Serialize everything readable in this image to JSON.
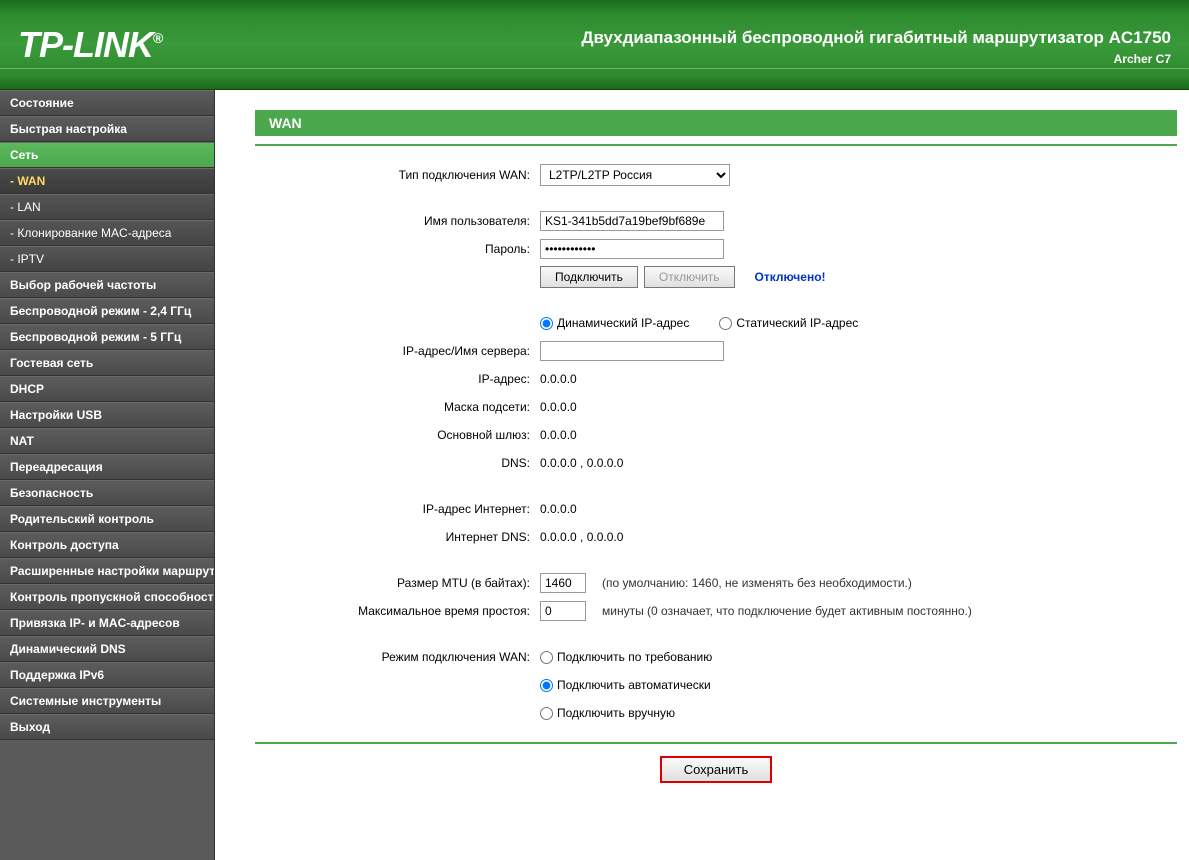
{
  "header": {
    "logo": "TP-LINK",
    "title": "Двухдиапазонный беспроводной гигабитный маршрутизатор AC1750",
    "subtitle": "Archer C7"
  },
  "sidebar": {
    "items": [
      {
        "label": "Состояние",
        "type": "main"
      },
      {
        "label": "Быстрая настройка",
        "type": "main"
      },
      {
        "label": "Сеть",
        "type": "main",
        "active": true
      },
      {
        "label": "- WAN",
        "type": "sub",
        "active_sub": true
      },
      {
        "label": "- LAN",
        "type": "sub"
      },
      {
        "label": "- Клонирование MAC-адреса",
        "type": "sub"
      },
      {
        "label": "- IPTV",
        "type": "sub"
      },
      {
        "label": "Выбор рабочей частоты",
        "type": "main"
      },
      {
        "label": "Беспроводной режим - 2,4 ГГц",
        "type": "main"
      },
      {
        "label": "Беспроводной режим - 5 ГГц",
        "type": "main"
      },
      {
        "label": "Гостевая сеть",
        "type": "main"
      },
      {
        "label": "DHCP",
        "type": "main"
      },
      {
        "label": "Настройки USB",
        "type": "main"
      },
      {
        "label": "NAT",
        "type": "main"
      },
      {
        "label": "Переадресация",
        "type": "main"
      },
      {
        "label": "Безопасность",
        "type": "main"
      },
      {
        "label": "Родительский контроль",
        "type": "main"
      },
      {
        "label": "Контроль доступа",
        "type": "main"
      },
      {
        "label": "Расширенные настройки маршрутизации",
        "type": "main"
      },
      {
        "label": "Контроль пропускной способности",
        "type": "main"
      },
      {
        "label": "Привязка IP- и MAC-адресов",
        "type": "main"
      },
      {
        "label": "Динамический DNS",
        "type": "main"
      },
      {
        "label": "Поддержка IPv6",
        "type": "main"
      },
      {
        "label": "Системные инструменты",
        "type": "main"
      },
      {
        "label": "Выход",
        "type": "main"
      }
    ]
  },
  "page": {
    "title": "WAN",
    "labels": {
      "conn_type": "Тип подключения WAN:",
      "username": "Имя пользователя:",
      "password": "Пароль:",
      "server_ip_name": "IP-адрес/Имя сервера:",
      "ip": "IP-адрес:",
      "netmask": "Маска подсети:",
      "gateway": "Основной шлюз:",
      "dns": "DNS:",
      "internet_ip": "IP-адрес Интернет:",
      "internet_dns": "Интернет DNS:",
      "mtu": "Размер MTU (в байтах):",
      "idle": "Максимальное время простоя:",
      "conn_mode": "Режим подключения WAN:"
    },
    "values": {
      "conn_type_selected": "L2TP/L2TP Россия",
      "username": "KS1-341b5dd7a19bef9bf689e",
      "password": "••••••••••••",
      "server_ip_name": "",
      "ip": "0.0.0.0",
      "netmask": "0.0.0.0",
      "gateway": "0.0.0.0",
      "dns": "0.0.0.0 , 0.0.0.0",
      "internet_ip": "0.0.0.0",
      "internet_dns": "0.0.0.0 , 0.0.0.0",
      "mtu": "1460",
      "idle": "0"
    },
    "buttons": {
      "connect": "Подключить",
      "disconnect": "Отключить",
      "save": "Сохранить"
    },
    "status": "Отключено!",
    "ip_mode": {
      "dynamic": "Динамический IP-адрес",
      "static": "Статический IP-адрес"
    },
    "hints": {
      "mtu": "(по умолчанию: 1460, не изменять без необходимости.)",
      "idle": "минуты (0 означает, что подключение будет активным постоянно.)"
    },
    "conn_modes": {
      "on_demand": "Подключить по требованию",
      "auto": "Подключить автоматически",
      "manual": "Подключить вручную"
    }
  }
}
